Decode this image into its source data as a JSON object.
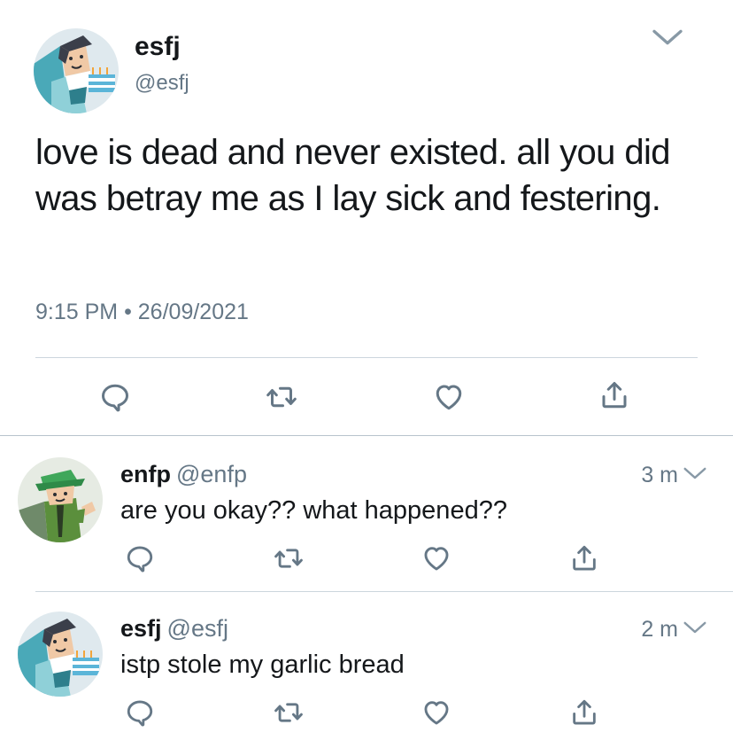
{
  "main_tweet": {
    "name": "esfj",
    "handle": "@esfj",
    "text": "love is dead and never existed. all you did was betray me as I lay sick and festering.",
    "time": "9:15 PM",
    "separator": "•",
    "date": "26/09/2021",
    "avatar_icon": "esfj-character-avatar",
    "menu_icon": "chevron-down-icon"
  },
  "replies": [
    {
      "name": "enfp",
      "handle": "@enfp",
      "time": "3 m",
      "text": "are you okay?? what happened??",
      "avatar_icon": "enfp-character-avatar"
    },
    {
      "name": "esfj",
      "handle": "@esfj",
      "time": "2 m",
      "text": "istp stole my garlic bread",
      "avatar_icon": "esfj-character-avatar"
    }
  ],
  "actions": [
    "reply-icon",
    "retweet-icon",
    "like-icon",
    "share-icon"
  ],
  "colors": {
    "text": "#14171a",
    "secondary": "#657786",
    "divider": "#ccd6dd"
  }
}
